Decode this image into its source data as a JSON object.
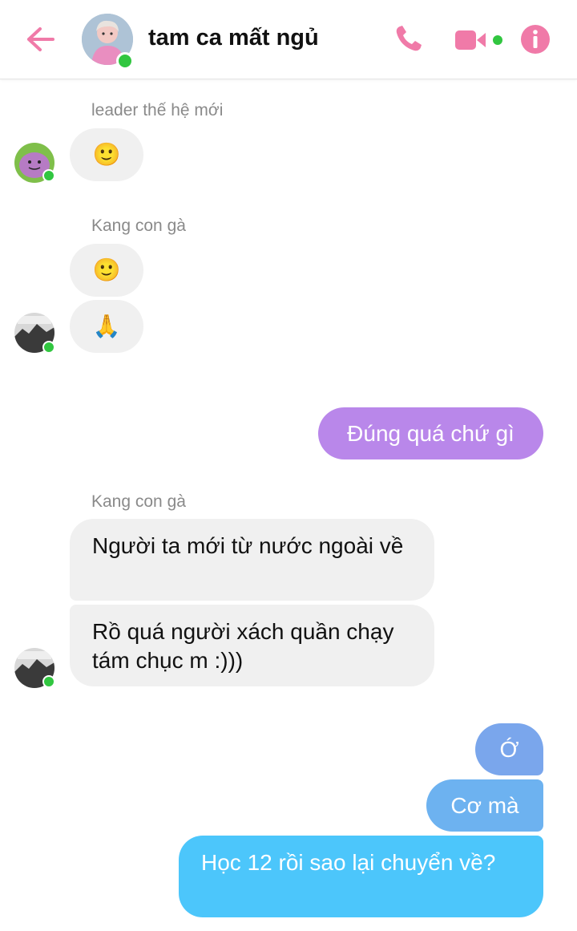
{
  "header": {
    "title": "tam ca mất ngủ",
    "icons": [
      "back-arrow-icon",
      "phone-icon",
      "video-call-icon",
      "info-icon"
    ],
    "accent": "#f07aa8"
  },
  "messages": [
    {
      "sender": "leader thế hệ mới",
      "content": [
        "🙂"
      ]
    },
    {
      "sender": "Kang con gà",
      "content": [
        "🙂",
        "🙏"
      ]
    },
    {
      "sender": "me",
      "content": [
        "Đúng quá chứ gì"
      ],
      "color": "#b987ea"
    },
    {
      "sender": "Kang con gà",
      "content": [
        "Người ta mới từ nước ngoài về",
        "Rồ quá người xách quần chạy tám chục m :)))"
      ]
    },
    {
      "sender": "me",
      "content": [
        "Ớ",
        "Cơ mà",
        "Học 12 rồi sao lại chuyển về?"
      ],
      "color": "#4cbcf5"
    }
  ],
  "colors": {
    "incoming_bubble": "#f0f0f0",
    "online": "#31c640",
    "gradient_top": "#7aa6ec",
    "gradient_bottom": "#4cc6fb"
  }
}
